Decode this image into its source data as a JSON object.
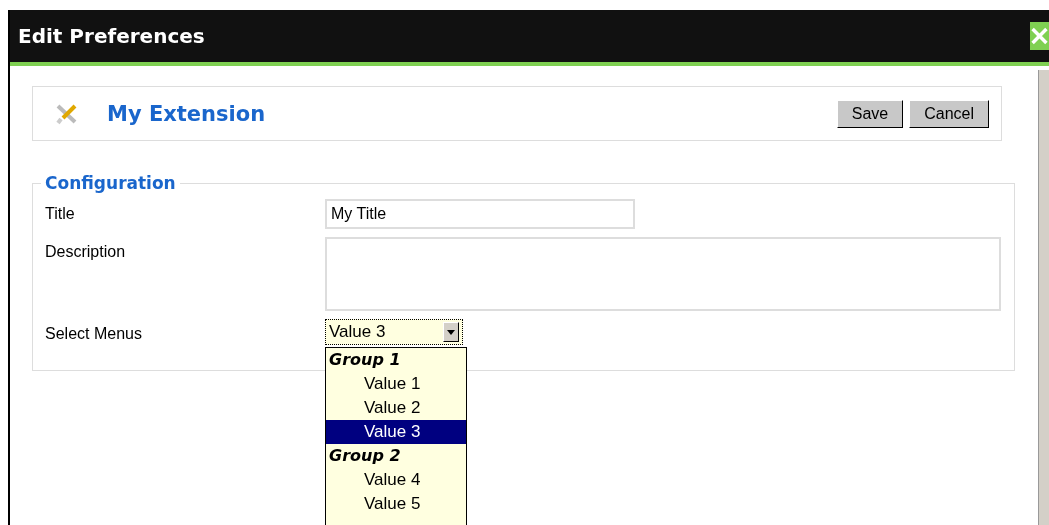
{
  "window": {
    "title": "Edit Preferences"
  },
  "header": {
    "title": "My Extension",
    "buttons": [
      "Save",
      "Cancel"
    ]
  },
  "configuration": {
    "legend": "Configuration",
    "fields": [
      {
        "kind": "text",
        "label": "Title",
        "value": "My Title"
      },
      {
        "kind": "textarea",
        "label": "Description"
      },
      {
        "kind": "select",
        "label": "Select Menus",
        "value": "Value 3"
      }
    ]
  },
  "dropdown": [
    {
      "kind": "group",
      "label": "Group 1"
    },
    {
      "kind": "option",
      "label": "Value 1",
      "selected": false
    },
    {
      "kind": "option",
      "label": "Value 2",
      "selected": false
    },
    {
      "kind": "option",
      "label": "Value 3",
      "selected": true
    },
    {
      "kind": "group",
      "label": "Group 2"
    },
    {
      "kind": "option",
      "label": "Value 4",
      "selected": false
    },
    {
      "kind": "option",
      "label": "Value 5",
      "selected": false
    }
  ]
}
